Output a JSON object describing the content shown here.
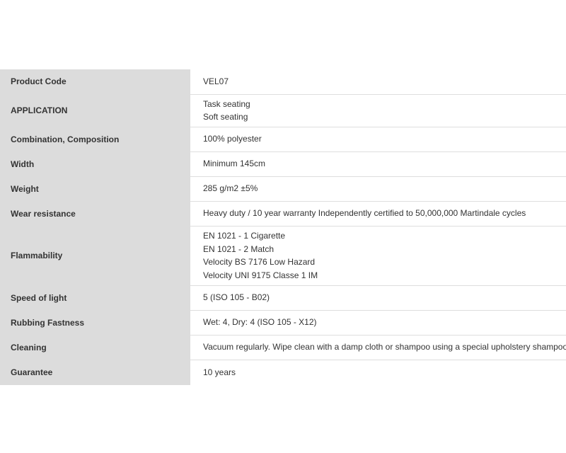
{
  "specs": [
    {
      "label": "Product Code",
      "values": [
        "VEL07"
      ]
    },
    {
      "label": "APPLICATION",
      "values": [
        "Task seating",
        "Soft seating"
      ]
    },
    {
      "label": "Combination, Composition",
      "values": [
        "100% polyester"
      ]
    },
    {
      "label": "Width",
      "values": [
        "Minimum 145cm"
      ]
    },
    {
      "label": "Weight",
      "values": [
        "285 g/m2 ±5%"
      ]
    },
    {
      "label": "Wear resistance",
      "values": [
        "Heavy duty / 10 year warranty Independently certified to 50,000,000 Martindale cycles"
      ]
    },
    {
      "label": "Flammability",
      "values": [
        "EN 1021 - 1 Cigarette",
        "EN 1021 - 2 Match",
        "Velocity BS 7176 Low Hazard",
        "Velocity UNI 9175 Classe 1 IM"
      ]
    },
    {
      "label": "Speed of light",
      "values": [
        "5 (ISO 105 - B02)"
      ]
    },
    {
      "label": "Rubbing Fastness",
      "values": [
        "Wet: 4, Dry: 4 (ISO 105 - X12)"
      ]
    },
    {
      "label": "Cleaning",
      "values": [
        "Vacuum regularly. Wipe clean with a damp cloth or shampoo using a special upholstery shampoo."
      ]
    },
    {
      "label": "Guarantee",
      "values": [
        "10 years"
      ]
    }
  ]
}
